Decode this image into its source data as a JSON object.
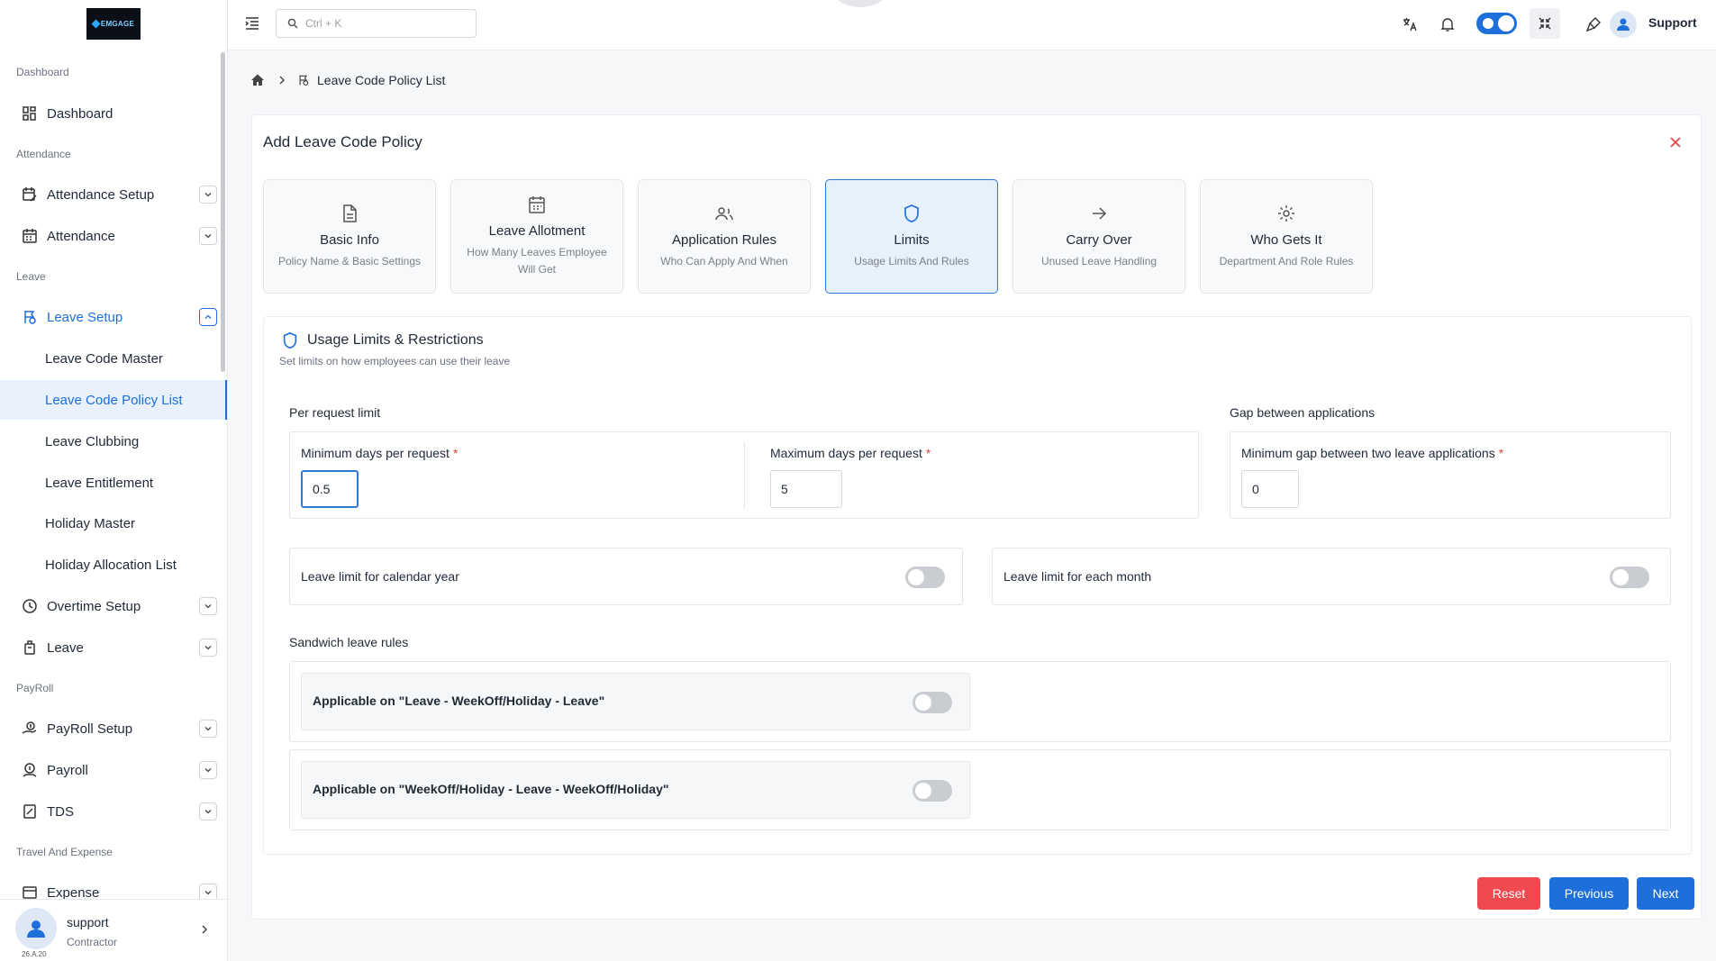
{
  "logo": {
    "text": "EMGAGE"
  },
  "sidebar": {
    "sections": {
      "dashboard": "Dashboard",
      "attendance": "Attendance",
      "leave": "Leave",
      "payroll": "PayRoll",
      "travel": "Travel And Expense"
    },
    "items": {
      "dashboard": "Dashboard",
      "attendance_setup": "Attendance Setup",
      "attendance": "Attendance",
      "leave_setup": "Leave Setup",
      "leave_code_master": "Leave Code Master",
      "leave_code_policy_list": "Leave Code Policy List",
      "leave_clubbing": "Leave Clubbing",
      "leave_entitlement": "Leave Entitlement",
      "holiday_master": "Holiday Master",
      "holiday_allocation_list": "Holiday Allocation List",
      "overtime_setup": "Overtime Setup",
      "leave": "Leave",
      "payroll_setup": "PayRoll Setup",
      "payroll": "Payroll",
      "tds": "TDS",
      "expense": "Expense"
    },
    "user": {
      "name": "support",
      "role": "Contractor",
      "version": "26.A.20"
    }
  },
  "topbar": {
    "search_placeholder": "Ctrl + K",
    "user": "Support",
    "theme_toggle_on": true
  },
  "breadcrumb": {
    "current": "Leave Code Policy List"
  },
  "card": {
    "title": "Add Leave Code Policy",
    "steps": [
      {
        "title": "Basic Info",
        "desc": "Policy Name & Basic Settings",
        "icon": "document-icon"
      },
      {
        "title": "Leave Allotment",
        "desc": "How Many Leaves Employee Will Get",
        "icon": "calendar-icon"
      },
      {
        "title": "Application Rules",
        "desc": "Who Can Apply And When",
        "icon": "users-icon"
      },
      {
        "title": "Limits",
        "desc": "Usage Limits And Rules",
        "icon": "shield-icon",
        "active": true
      },
      {
        "title": "Carry Over",
        "desc": "Unused Leave Handling",
        "icon": "arrow-right-icon"
      },
      {
        "title": "Who Gets It",
        "desc": "Department And Role Rules",
        "icon": "gear-icon"
      }
    ]
  },
  "limits": {
    "title": "Usage Limits & Restrictions",
    "subtitle": "Set limits on how employees can use their leave",
    "per_request": {
      "label": "Per request limit",
      "min_label": "Minimum days per request",
      "min_value": "0.5",
      "max_label": "Maximum days per request",
      "max_value": "5"
    },
    "gap": {
      "label": "Gap between applications",
      "min_gap_label": "Minimum gap between two leave applications",
      "min_gap_value": "0"
    },
    "calendar_year": {
      "label": "Leave limit for calendar year",
      "enabled": false
    },
    "each_month": {
      "label": "Leave limit for each month",
      "enabled": false
    },
    "sandwich": {
      "label": "Sandwich leave rules",
      "rule1": "Applicable on \"Leave - WeekOff/Holiday - Leave\"",
      "rule1_enabled": false,
      "rule2": "Applicable on \"WeekOff/Holiday - Leave - WeekOff/Holiday\"",
      "rule2_enabled": false
    },
    "required_mark": "*"
  },
  "buttons": {
    "reset": "Reset",
    "previous": "Previous",
    "next": "Next"
  },
  "colors": {
    "primary": "#1e6fd9",
    "danger": "#ee4a4f",
    "active_step_bg": "#e6f1fc"
  }
}
